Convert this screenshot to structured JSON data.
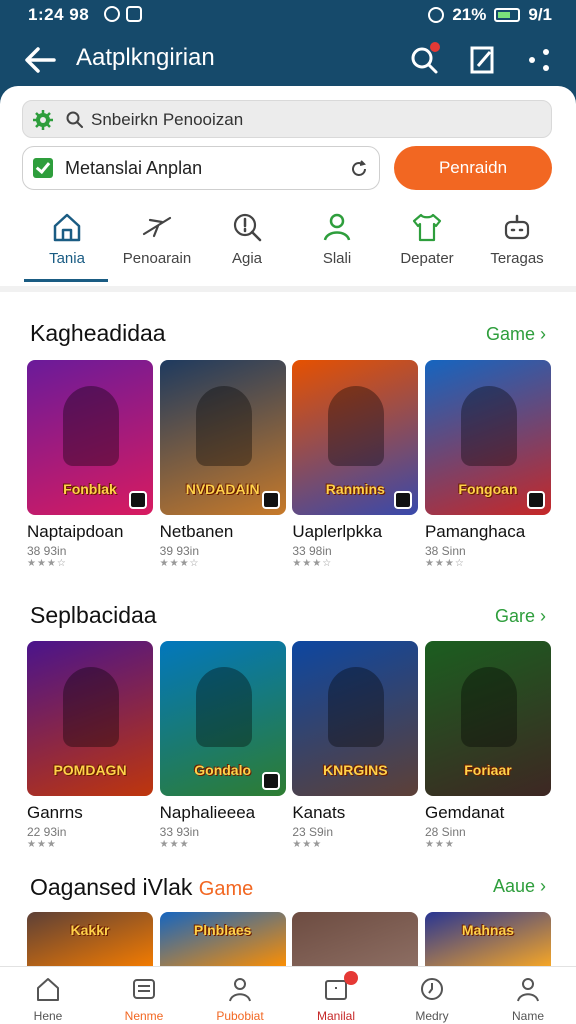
{
  "status_bar": {
    "time": "1:24 98",
    "battery": "21%",
    "extra": "9/1"
  },
  "header": {
    "title": "Aatplkngirian"
  },
  "search": {
    "placeholder": "Snbeirkn Penooizan"
  },
  "filter": {
    "value": "Metanslai Anplan",
    "action_label": "Penraidn"
  },
  "categories": [
    {
      "label": "Tania",
      "icon": "home-icon",
      "active": true
    },
    {
      "label": "Penoarain",
      "icon": "plane-icon"
    },
    {
      "label": "Agia",
      "icon": "alert-search-icon"
    },
    {
      "label": "Slali",
      "icon": "user-icon"
    },
    {
      "label": "Depater",
      "icon": "shirt-icon"
    },
    {
      "label": "Teragas",
      "icon": "robot-icon"
    }
  ],
  "sections": [
    {
      "title": "Kagheadidaa",
      "link": "Game ›",
      "games": [
        {
          "name": "Naptaipdoan",
          "meta": "38 93in",
          "cover_text": "Fonblak",
          "colors": [
            "#6a1b9a",
            "#d81b60"
          ]
        },
        {
          "name": "Netbanen",
          "meta": "39 93in",
          "cover_text": "NVDADAIN",
          "colors": [
            "#1e3a5f",
            "#c77a2a"
          ]
        },
        {
          "name": "Uaplerlpkka",
          "meta": "33 98in",
          "cover_text": "Ranmins",
          "colors": [
            "#e65100",
            "#3949ab"
          ]
        },
        {
          "name": "Pamanghaca",
          "meta": "38 Sinn",
          "cover_text": "Fongoan",
          "colors": [
            "#1565c0",
            "#c62828"
          ]
        }
      ]
    },
    {
      "title": "Seplbacidaa",
      "link": "Gare ›",
      "games": [
        {
          "name": "Ganrns",
          "meta": "22 93in",
          "cover_text": "POMDAGN",
          "colors": [
            "#4a148c",
            "#bf360c"
          ]
        },
        {
          "name": "Naphalieeea",
          "meta": "33 93in",
          "cover_text": "Gondalo",
          "colors": [
            "#0277bd",
            "#2e7d32"
          ]
        },
        {
          "name": "Kanats",
          "meta": "23 S9in",
          "cover_text": "KNRGINS",
          "colors": [
            "#0d47a1",
            "#5d4037"
          ]
        },
        {
          "name": "Gemdanat",
          "meta": "28 Sinn",
          "cover_text": "Foriaar",
          "colors": [
            "#1b5e20",
            "#3e2723"
          ]
        }
      ]
    },
    {
      "title": "Oagansed iVlak",
      "title_accent": "Game",
      "link": "Aaue ›",
      "games": [
        {
          "cover_text": "Kakkr",
          "colors": [
            "#5d4037",
            "#f57c00"
          ]
        },
        {
          "cover_text": "Plnblaes",
          "colors": [
            "#1565c0",
            "#ff8f00"
          ]
        },
        {
          "cover_text": "",
          "colors": [
            "#6d4c41",
            "#8d6e63"
          ]
        },
        {
          "cover_text": "Mahnas",
          "colors": [
            "#283593",
            "#f9a825"
          ]
        }
      ]
    }
  ],
  "bottom_nav": [
    {
      "label": "Hene",
      "icon": "home-icon",
      "tone": "grey"
    },
    {
      "label": "Nenme",
      "icon": "list-icon",
      "tone": "orange"
    },
    {
      "label": "Pubobiat",
      "icon": "profile-icon",
      "tone": "orange"
    },
    {
      "label": "Manilal",
      "icon": "inbox-icon",
      "tone": "red",
      "badge": true
    },
    {
      "label": "Medry",
      "icon": "clock-icon",
      "tone": "grey"
    },
    {
      "label": "Name",
      "icon": "person-icon",
      "tone": "grey"
    }
  ],
  "colors": {
    "header": "#164a6b",
    "accent": "#f26722",
    "link": "#2e9e3c",
    "active_tab": "#1a5c83"
  }
}
